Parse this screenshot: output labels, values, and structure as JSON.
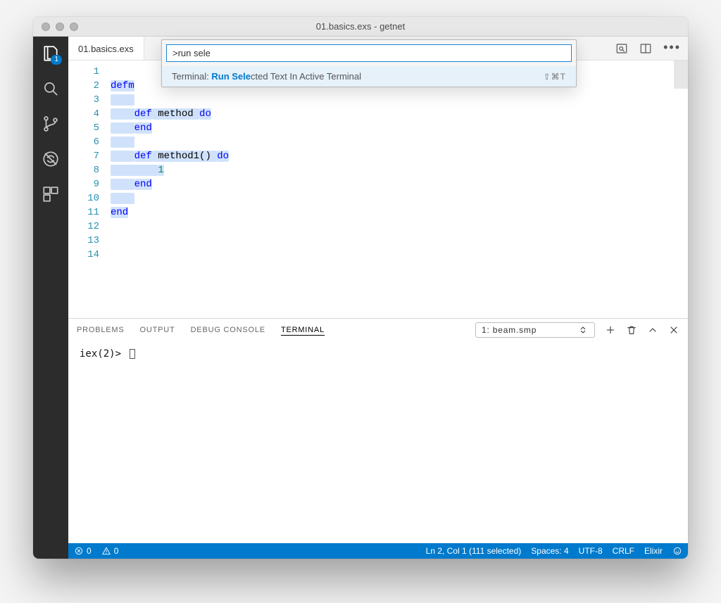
{
  "titlebar": {
    "title": "01.basics.exs - getnet"
  },
  "activitybar": {
    "badge": "1"
  },
  "tabs": {
    "file_label": "01.basics.exs"
  },
  "command_palette": {
    "input_value": ">run sele",
    "result_prefix": "Terminal: ",
    "result_hl": "Run Sele",
    "result_rest": "cted Text In Active Terminal",
    "shortcut": "⇧⌘T"
  },
  "editor": {
    "line_numbers": [
      "1",
      "2",
      "3",
      "4",
      "5",
      "6",
      "7",
      "8",
      "9",
      "10",
      "11",
      "12",
      "13",
      "14"
    ],
    "lines": [
      {
        "t": ""
      },
      {
        "t": "defm",
        "cls": "kw sel"
      },
      {
        "t": "",
        "indent_sel": true
      },
      {
        "segments": [
          {
            "pre": "    "
          },
          {
            "t": "def",
            "cls": "kw sel"
          },
          {
            "t": " method ",
            "cls": "norm sel"
          },
          {
            "t": "do",
            "cls": "kw sel"
          }
        ]
      },
      {
        "segments": [
          {
            "pre": "    "
          },
          {
            "t": "end",
            "cls": "kw sel"
          }
        ]
      },
      {
        "t": "",
        "indent_sel": true
      },
      {
        "segments": [
          {
            "pre": "    "
          },
          {
            "t": "def",
            "cls": "kw sel"
          },
          {
            "t": " method1() ",
            "cls": "norm sel"
          },
          {
            "t": "do",
            "cls": "kw sel"
          }
        ]
      },
      {
        "segments": [
          {
            "pre": "        "
          },
          {
            "t": "1",
            "cls": "num sel"
          }
        ]
      },
      {
        "segments": [
          {
            "pre": "    "
          },
          {
            "t": "end",
            "cls": "kw sel"
          }
        ]
      },
      {
        "t": "",
        "indent_sel": true
      },
      {
        "segments": [
          {
            "t": "end",
            "cls": "kw sel"
          }
        ]
      },
      {
        "t": ""
      },
      {
        "t": ""
      },
      {
        "t": ""
      }
    ]
  },
  "panel": {
    "tabs": {
      "problems": "PROBLEMS",
      "output": "OUTPUT",
      "debug_console": "DEBUG CONSOLE",
      "terminal": "TERMINAL"
    },
    "terminal_select": "1: beam.smp",
    "prompt": "iex(2)> "
  },
  "statusbar": {
    "errors": "0",
    "warnings": "0",
    "position": "Ln 2, Col 1 (111 selected)",
    "spaces": "Spaces: 4",
    "encoding": "UTF-8",
    "eol": "CRLF",
    "language": "Elixir"
  }
}
